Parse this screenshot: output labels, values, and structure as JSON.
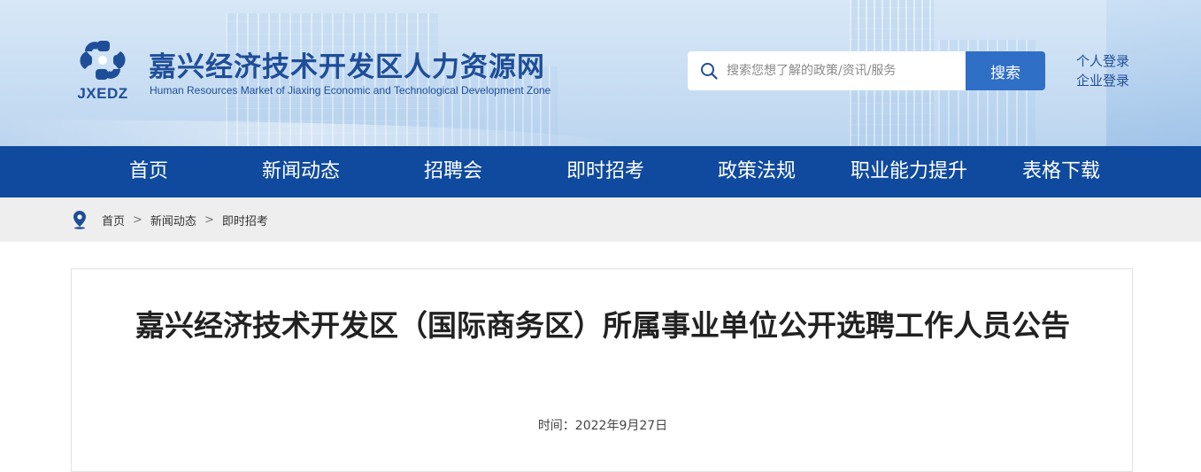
{
  "header": {
    "logo_abbr": "JXEDZ",
    "site_title": "嘉兴经济技术开发区人力资源网",
    "site_subtitle": "Human Resources Market of Jiaxing Economic and Technological Development Zone",
    "search": {
      "placeholder": "搜索您想了解的政策/资讯/服务",
      "button_label": "搜索"
    },
    "login": {
      "personal": "个人登录",
      "company": "企业登录"
    }
  },
  "nav": {
    "items": [
      {
        "label": "首页"
      },
      {
        "label": "新闻动态"
      },
      {
        "label": "招聘会"
      },
      {
        "label": "即时招考"
      },
      {
        "label": "政策法规"
      },
      {
        "label": "职业能力提升"
      },
      {
        "label": "表格下载"
      }
    ]
  },
  "breadcrumb": {
    "items": [
      "首页",
      "新闻动态",
      "即时招考"
    ],
    "separator": ">"
  },
  "article": {
    "title": "嘉兴经济技术开发区（国际商务区）所属事业单位公开选聘工作人员公告",
    "date": "时间：2022年9月27日"
  },
  "colors": {
    "brand_blue": "#1f4e98",
    "nav_bg": "#0f4a9e",
    "search_button": "#2f6fc6",
    "breadcrumb_bg": "#eeeeee"
  },
  "icons": {
    "logo": "jxedz-logo-icon",
    "search": "search-icon",
    "location": "location-pin-icon"
  }
}
